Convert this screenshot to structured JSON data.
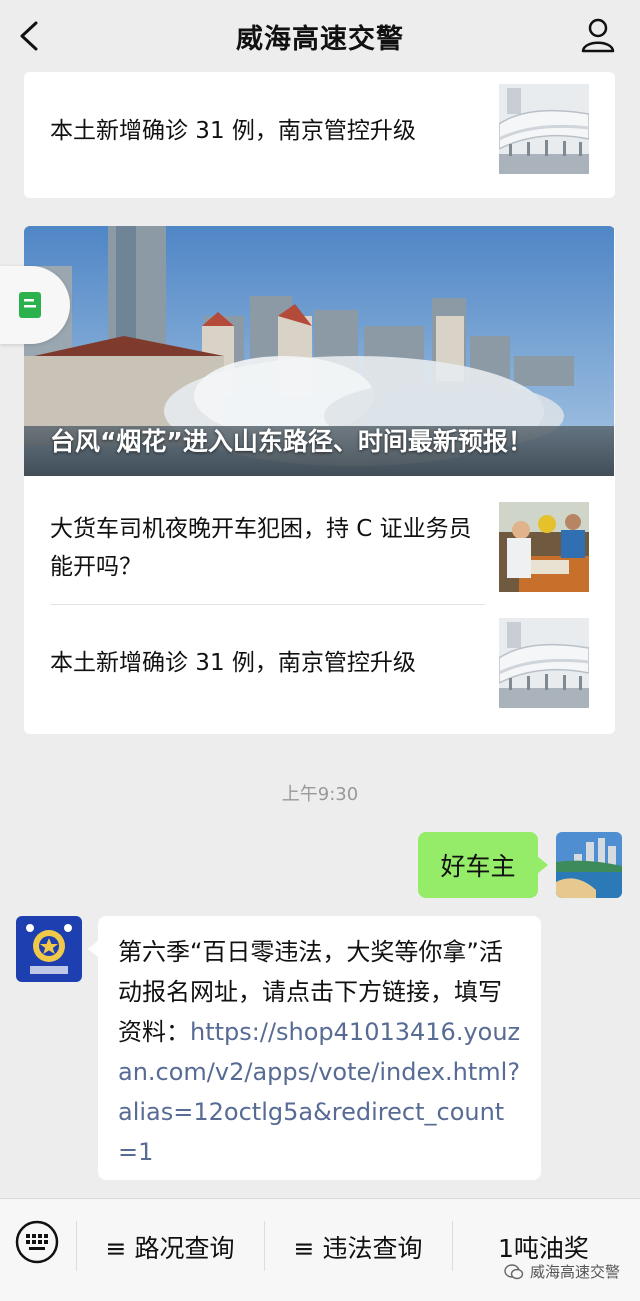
{
  "header": {
    "title": "威海高速交警"
  },
  "card_top": {
    "item": {
      "title": "本土新增确诊 31 例，南京管控升级"
    }
  },
  "card_main": {
    "hero_title": "台风“烟花”进入山东路径、时间最新预报！",
    "items": [
      {
        "title": "大货车司机夜晚开车犯困，持 C 证业务员能开吗？"
      },
      {
        "title": "本土新增确诊 31 例，南京管控升级"
      }
    ]
  },
  "chat": {
    "timestamp": "上午9:30",
    "outgoing": {
      "text": "好车主"
    },
    "incoming": {
      "text": "第六季“百日零违法，大奖等你拿”活动报名网址，请点击下方链接，填写资料：",
      "link": "https://shop41013416.youzan.com/v2/apps/vote/index.html?alias=12octlg5a&redirect_count=1"
    }
  },
  "menu": {
    "items": [
      {
        "label": "≡ 路况查询"
      },
      {
        "label": "≡ 违法查询"
      },
      {
        "label": "1吨油奖"
      }
    ]
  },
  "watermark": {
    "text": "威海高速交警"
  },
  "colors": {
    "bubble_out": "#95ec69",
    "link": "#576b95",
    "side_tab_icon": "#2bb24c"
  }
}
